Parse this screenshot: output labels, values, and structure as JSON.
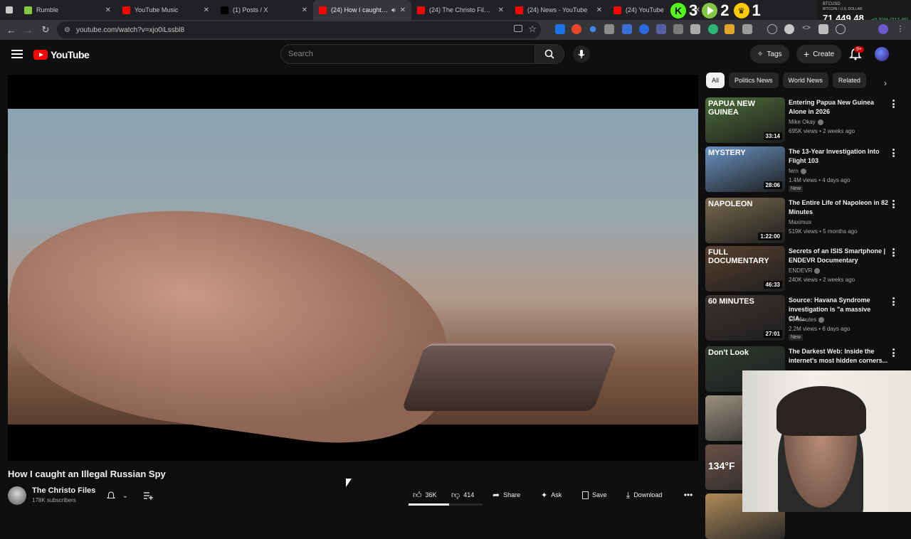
{
  "browser": {
    "tabs": [
      {
        "title": "Rumble",
        "favicon_color": "#85c742",
        "active": false,
        "muted": false
      },
      {
        "title": "YouTube Music",
        "favicon_color": "#ff0000",
        "active": false,
        "muted": false
      },
      {
        "title": "(1) Posts / X",
        "favicon_color": "#000000",
        "active": false,
        "muted": false
      },
      {
        "title": "(24) How I caught an",
        "favicon_color": "#ff0000",
        "active": true,
        "muted": true
      },
      {
        "title": "(24) The Christo Files - Yo",
        "favicon_color": "#ff0000",
        "active": false,
        "muted": false
      },
      {
        "title": "(24) News - YouTube",
        "favicon_color": "#ff0000",
        "active": false,
        "muted": false
      },
      {
        "title": "(24) YouTube",
        "favicon_color": "#ff0000",
        "active": false,
        "muted": false
      }
    ],
    "url": "youtube.com/watch?v=xjo0iLssbl8",
    "scores": [
      {
        "value": "3",
        "icon": "kick-icon",
        "color": "#53fc18"
      },
      {
        "value": "2",
        "icon": "rumble-play-icon",
        "color": "#85c742"
      },
      {
        "value": "1",
        "icon": "crown-icon",
        "color": "#ffcc00"
      }
    ],
    "ticker": {
      "symbol": "BTCUSD",
      "subtitle": "BITCOIN / U.S. DOLLAR",
      "price": "71,449.48",
      "change": "+0.31% (217.46)",
      "change_color": "#3ec46d"
    }
  },
  "youtube": {
    "logo_text": "YouTube",
    "search_placeholder": "Search",
    "header_buttons": {
      "tags": "Tags",
      "create": "Create"
    },
    "notification_badge": "9+"
  },
  "video": {
    "title": "How I caught an Illegal Russian Spy",
    "channel": "The Christo Files",
    "subscribers": "178K subscribers",
    "likes": "36K",
    "dislikes": "414",
    "like_ratio": 0.55,
    "actions": {
      "share": "Share",
      "ask": "Ask",
      "save": "Save",
      "download": "Download"
    }
  },
  "sidebar": {
    "chips": [
      "All",
      "Politics News",
      "World News",
      "Related"
    ],
    "selected_chip": "All",
    "recommendations": [
      {
        "title": "Entering Papua New Guinea Alone in 2026",
        "channel": "Mike Okay",
        "verified": true,
        "meta": "695K views • 2 weeks ago",
        "duration": "33:14",
        "new": false,
        "overlay": "PAPUA NEW GUINEA",
        "thumb_color": "#4f6d3a"
      },
      {
        "title": "The 13-Year Investigation Into Flight 103",
        "channel": "fern",
        "verified": true,
        "meta": "1.4M views • 4 days ago",
        "duration": "28:06",
        "new": true,
        "overlay": "MYSTERY",
        "thumb_color": "#6a93c4"
      },
      {
        "title": "The Entire Life of Napoleon in 82 Minutes",
        "channel": "Maximus",
        "verified": false,
        "meta": "519K views • 5 months ago",
        "duration": "1:22:00",
        "new": false,
        "overlay": "NAPOLEON",
        "thumb_color": "#7a6a50"
      },
      {
        "title": "Secrets of an ISIS Smartphone | ENDEVR Documentary",
        "channel": "ENDEVR",
        "verified": true,
        "meta": "240K views • 2 weeks ago",
        "duration": "46:33",
        "new": false,
        "overlay": "FULL DOCUMENTARY",
        "thumb_color": "#5a4130"
      },
      {
        "title": "Source: Havana Syndrome investigation is \"a massive CIA...",
        "channel": "60 Minutes",
        "verified": true,
        "meta": "2.2M views • 6 days ago",
        "duration": "27:01",
        "new": true,
        "overlay": "60 MINUTES",
        "thumb_color": "#3c3430"
      },
      {
        "title": "The Darkest Web: Inside the internet's most hidden corners...",
        "channel": "",
        "verified": false,
        "meta": "",
        "duration": "",
        "new": false,
        "overlay": "Don't Look",
        "thumb_color": "#2d3a30"
      }
    ],
    "partial_thumbs": [
      {
        "overlay": "",
        "thumb_color": "#9c9080"
      },
      {
        "overlay": "134°F",
        "thumb_color": "#6a5048"
      },
      {
        "overlay": "",
        "thumb_color": "#b08a58"
      }
    ]
  }
}
